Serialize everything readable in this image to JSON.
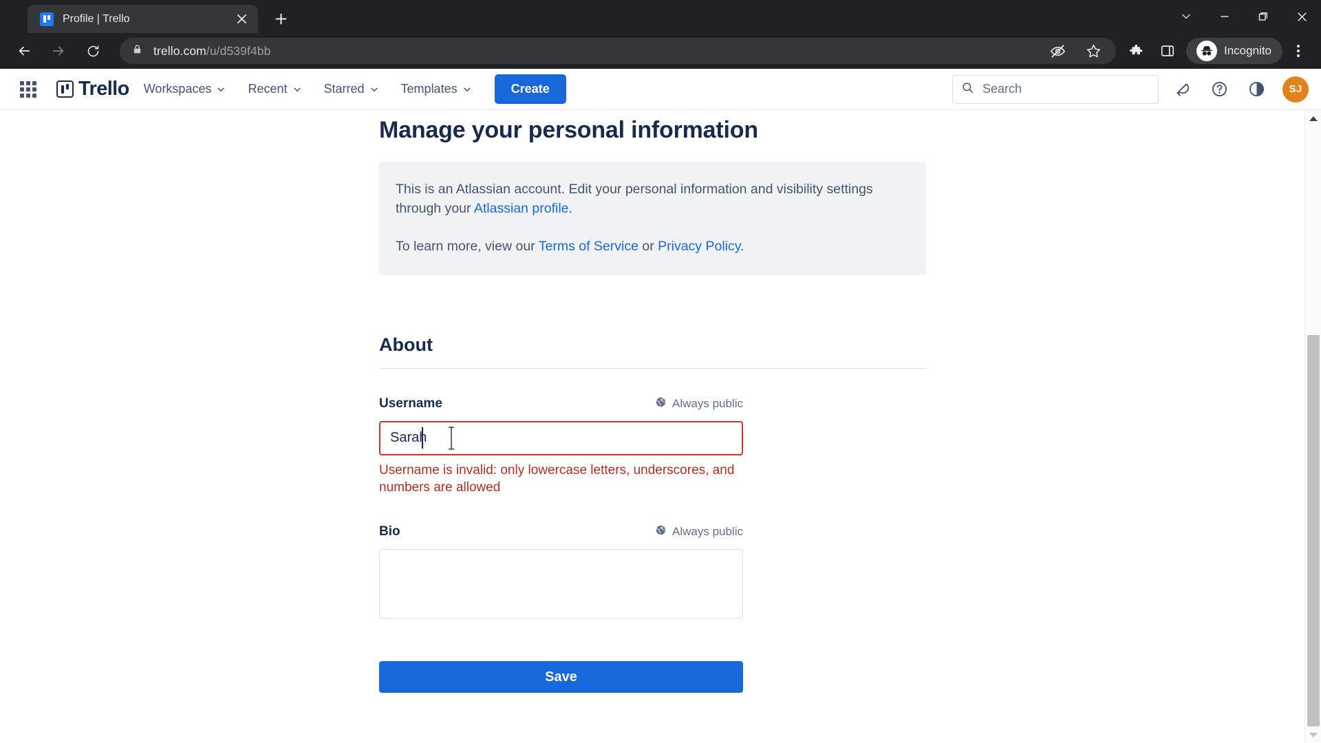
{
  "browser": {
    "tab": {
      "title": "Profile | Trello",
      "favicon": "trello-favicon"
    },
    "newtab_label": "+",
    "url": {
      "domain": "trello.com",
      "path": "/u/d539f4bb"
    },
    "profile_pill_label": "Incognito",
    "icons": {
      "back": "back-arrow-icon",
      "forward": "forward-arrow-icon",
      "reload": "reload-icon",
      "site_info": "lock-icon",
      "tracking": "eye-slash-icon",
      "bookmark": "star-icon",
      "extensions": "puzzle-piece-icon",
      "side_panel": "side-panel-icon",
      "menu": "three-dot-menu-icon",
      "tab_search": "chevron-down-icon",
      "minimize": "minimize-icon",
      "maximize": "maximize-icon",
      "close": "close-icon"
    }
  },
  "app_header": {
    "brand": "Trello",
    "nav": [
      {
        "label": "Workspaces"
      },
      {
        "label": "Recent"
      },
      {
        "label": "Starred"
      },
      {
        "label": "Templates"
      }
    ],
    "create_label": "Create",
    "search_placeholder": "Search",
    "search_value": "",
    "avatar_initials": "SJ",
    "icons": {
      "apps_grid": "apps-grid-icon",
      "search": "search-icon",
      "notifications": "bell-icon",
      "help": "question-circle-icon",
      "theme": "theme-contrast-icon"
    }
  },
  "main": {
    "title": "Manage your personal information",
    "info": {
      "line1_before": "This is an Atlassian account. Edit your personal information and visibility settings through your ",
      "line1_link": "Atlassian profile",
      "line1_after": ".",
      "line2_before": "To learn more, view our ",
      "line2_link1": "Terms of Service",
      "line2_middle": " or ",
      "line2_link2": "Privacy Policy",
      "line2_after": "."
    },
    "section_title": "About",
    "fields": {
      "username": {
        "label": "Username",
        "visibility": "Always public",
        "value": "Sarah",
        "placeholder": "",
        "error": "Username is invalid: only lowercase letters, underscores, and numbers are allowed",
        "invalid": true
      },
      "bio": {
        "label": "Bio",
        "visibility": "Always public",
        "value": "",
        "placeholder": ""
      }
    },
    "save_label": "Save"
  },
  "colors": {
    "accent_blue": "#1868db",
    "error_red": "#c9372c",
    "error_text": "#ae2e24",
    "avatar_orange": "#e2821a",
    "chrome_dark": "#202124"
  }
}
